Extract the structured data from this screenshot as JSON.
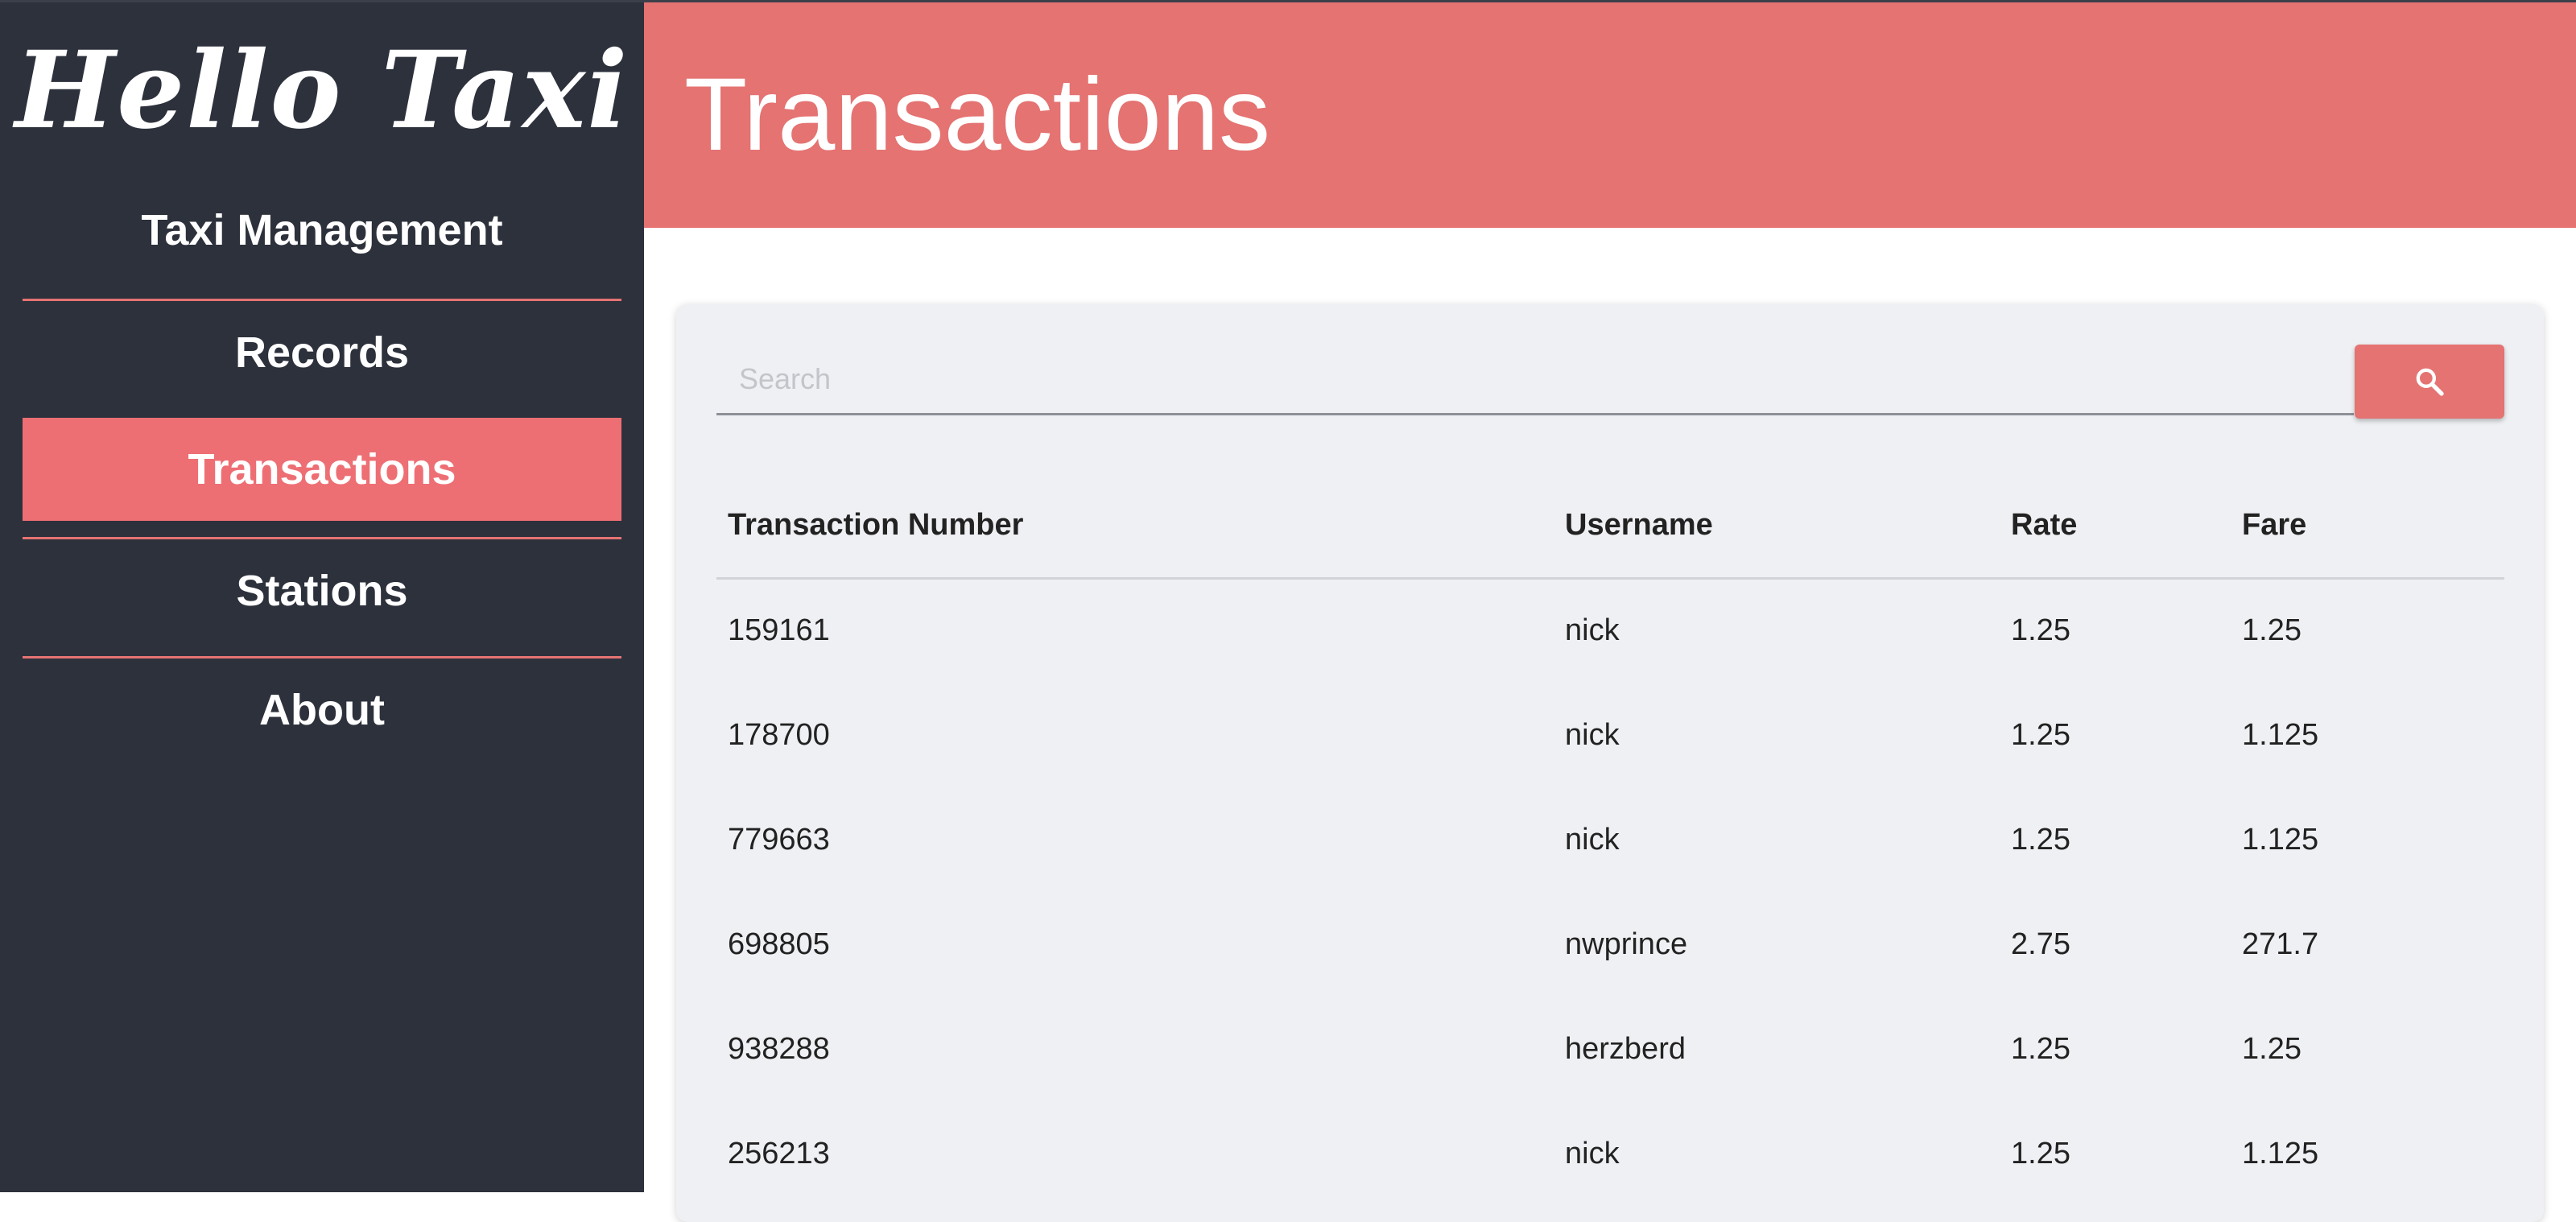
{
  "sidebar": {
    "brand": "Hello Taxi",
    "subtitle": "Taxi Management",
    "items": [
      {
        "label": "Records"
      },
      {
        "label": "Transactions"
      },
      {
        "label": "Stations"
      },
      {
        "label": "About"
      }
    ],
    "active_item": "Transactions"
  },
  "header": {
    "title": "Transactions"
  },
  "search": {
    "placeholder": "Search",
    "value": "",
    "button_icon": "search-icon"
  },
  "table": {
    "columns": [
      "Transaction Number",
      "Username",
      "Rate",
      "Fare"
    ],
    "rows": [
      [
        "159161",
        "nick",
        "1.25",
        "1.25"
      ],
      [
        "178700",
        "nick",
        "1.25",
        "1.125"
      ],
      [
        "779663",
        "nick",
        "1.25",
        "1.125"
      ],
      [
        "698805",
        "nwprince",
        "2.75",
        "271.7"
      ],
      [
        "938288",
        "herzberd",
        "1.25",
        "1.25"
      ],
      [
        "256213",
        "nick",
        "1.25",
        "1.125"
      ]
    ]
  },
  "colors": {
    "sidebar_bg": "#2d313c",
    "accent": "#e47372",
    "active_item_bg": "#ed6f74",
    "card_bg": "#eff0f3"
  }
}
